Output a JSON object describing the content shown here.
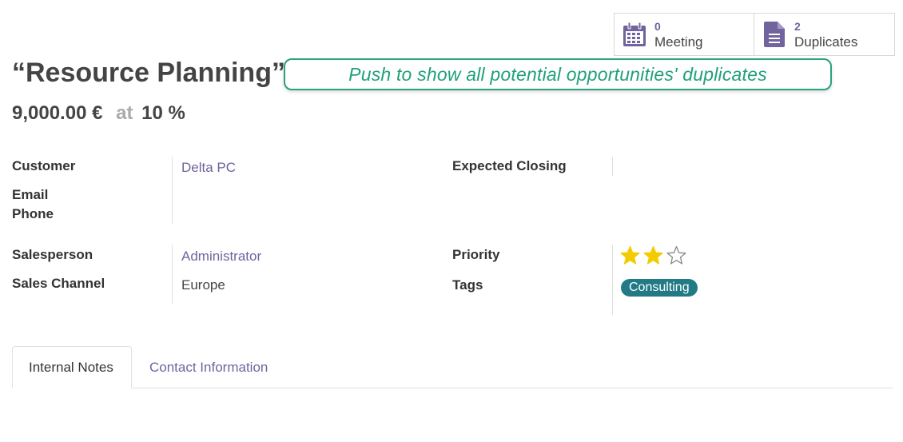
{
  "smart_buttons": [
    {
      "count": "0",
      "label": "Meeting",
      "icon": "calendar-icon"
    },
    {
      "count": "2",
      "label": "Duplicates",
      "icon": "document-icon"
    }
  ],
  "record": {
    "title": "“Resource Planning”",
    "amount": "9,000.00 €",
    "at_label": "at",
    "probability": "10 %"
  },
  "tooltip": {
    "text": "Push to show all potential opportunities' duplicates"
  },
  "fields": {
    "customer_label": "Customer",
    "customer_value": "Delta PC",
    "email_label": "Email",
    "phone_label": "Phone",
    "expected_closing_label": "Expected Closing",
    "salesperson_label": "Salesperson",
    "salesperson_value": "Administrator",
    "sales_channel_label": "Sales Channel",
    "sales_channel_value": "Europe",
    "priority_label": "Priority",
    "priority_value": 2,
    "priority_max": 3,
    "tags_label": "Tags",
    "tag_value": "Consulting"
  },
  "tabs": [
    {
      "label": "Internal Notes",
      "active": true
    },
    {
      "label": "Contact Information",
      "active": false
    }
  ],
  "colors": {
    "accent": "#71639e",
    "tooltip": "#21a07a",
    "star": "#f3cc00",
    "tag": "#217a86"
  }
}
